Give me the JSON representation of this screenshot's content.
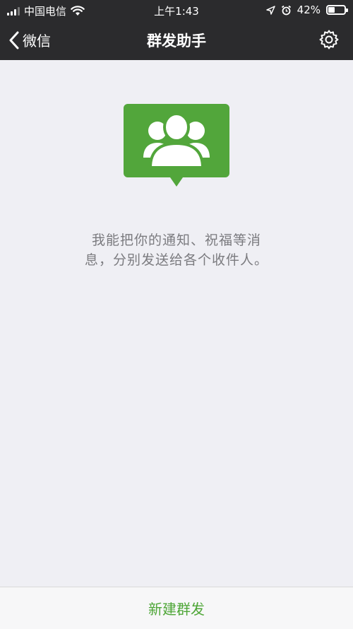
{
  "status_bar": {
    "carrier": "中国电信",
    "time": "上午1:43",
    "battery_percent_label": "42%",
    "battery_level": 0.42
  },
  "navbar": {
    "back_label": "微信",
    "title": "群发助手"
  },
  "main": {
    "description_line1": "我能把你的通知、祝福等消",
    "description_line2": "息，分别发送给各个收件人。"
  },
  "footer": {
    "new_broadcast_label": "新建群发"
  },
  "colors": {
    "accent_green": "#4ea637",
    "navbar_bg": "#2b2b2d",
    "page_bg": "#efeff4"
  }
}
